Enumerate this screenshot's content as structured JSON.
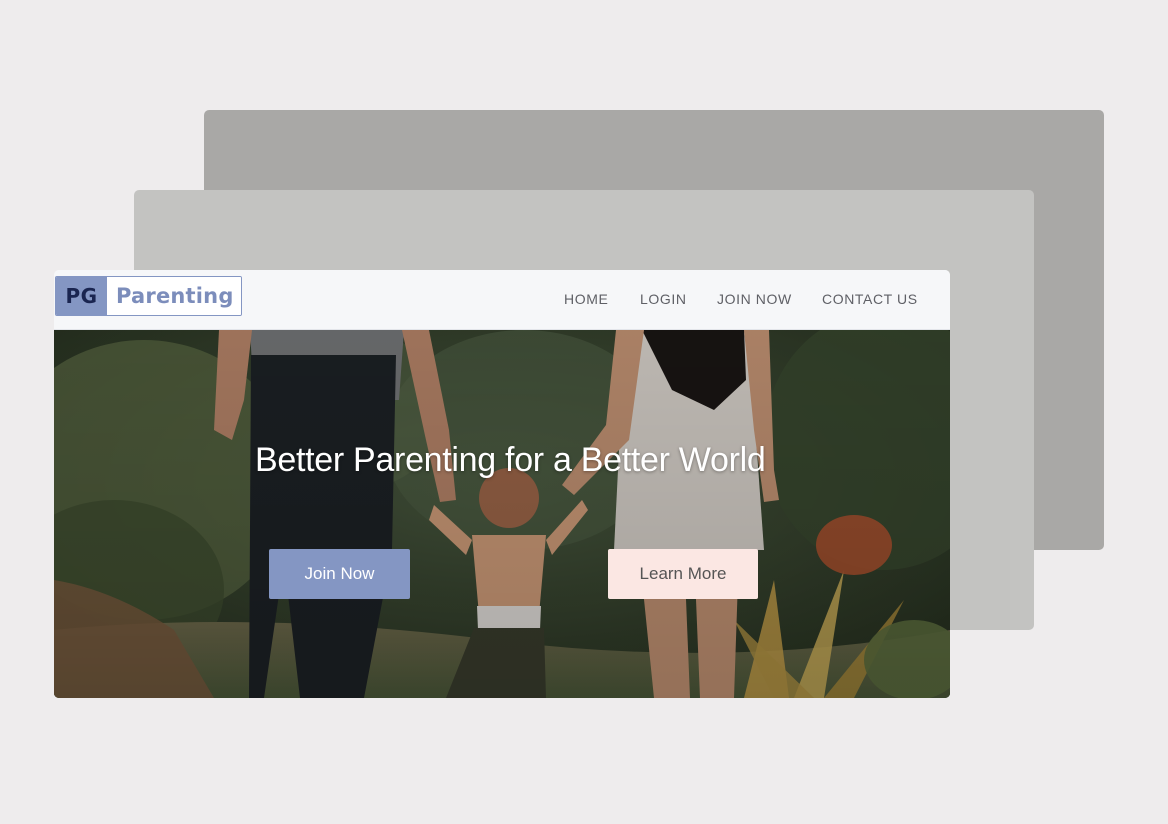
{
  "logo": {
    "mark": "PG",
    "word": "Parenting"
  },
  "nav": {
    "items": [
      {
        "label": "HOME"
      },
      {
        "label": "LOGIN"
      },
      {
        "label": "JOIN NOW"
      },
      {
        "label": "CONTACT US"
      }
    ]
  },
  "hero": {
    "title": "Better Parenting for a Better World",
    "primary_button": "Join Now",
    "secondary_button": "Learn More",
    "image": "family-walking-photo"
  },
  "colors": {
    "background": "#eeeced",
    "brand": "#8496c3",
    "nav_background": "#f6f7f9",
    "secondary_button": "#fbe7e3"
  }
}
